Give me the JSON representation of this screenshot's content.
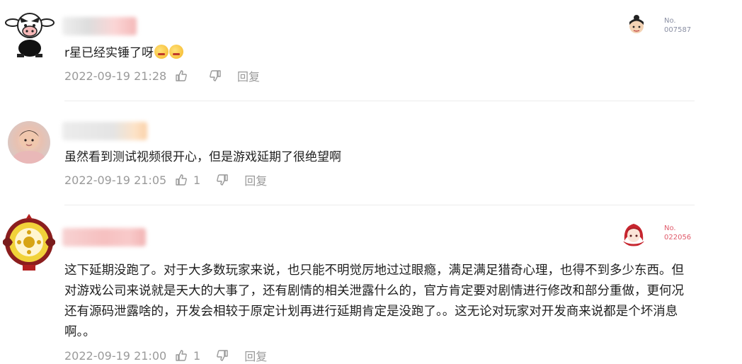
{
  "comments": [
    {
      "text": "r星已经实锤了呀",
      "emojis": [
        "facepalm-emoji",
        "facepalm-emoji"
      ],
      "time": "2022-09-19 21:28",
      "likes": "",
      "reply_label": "回复",
      "badge": {
        "line1": "No.",
        "line2": "007587"
      }
    },
    {
      "text": "虽然看到测试视频很开心，但是游戏延期了很绝望啊",
      "time": "2022-09-19 21:05",
      "likes": "1",
      "reply_label": "回复"
    },
    {
      "text": "这下延期没跑了。对于大多数玩家来说，也只能不明觉厉地过过眼瘾，满足满足猎奇心理，也得不到多少东西。但对游戏公司来说就是天大的大事了，还有剧情的相关泄露什么的，官方肯定要对剧情进行修改和部分重做，更何况还有源码泄露啥的，开发会相较于原定计划再进行延期肯定是没跑了。。这无论对玩家对开发商来说都是个坏消息啊。。",
      "time": "2022-09-19 21:00",
      "likes": "1",
      "reply_label": "回复",
      "badge": {
        "line1": "No.",
        "line2": "022056"
      }
    }
  ],
  "colors": {
    "meta": "#9a9a9a",
    "text": "#1f1f1f",
    "badge": "#8a8fa3",
    "divider": "#ececec"
  }
}
